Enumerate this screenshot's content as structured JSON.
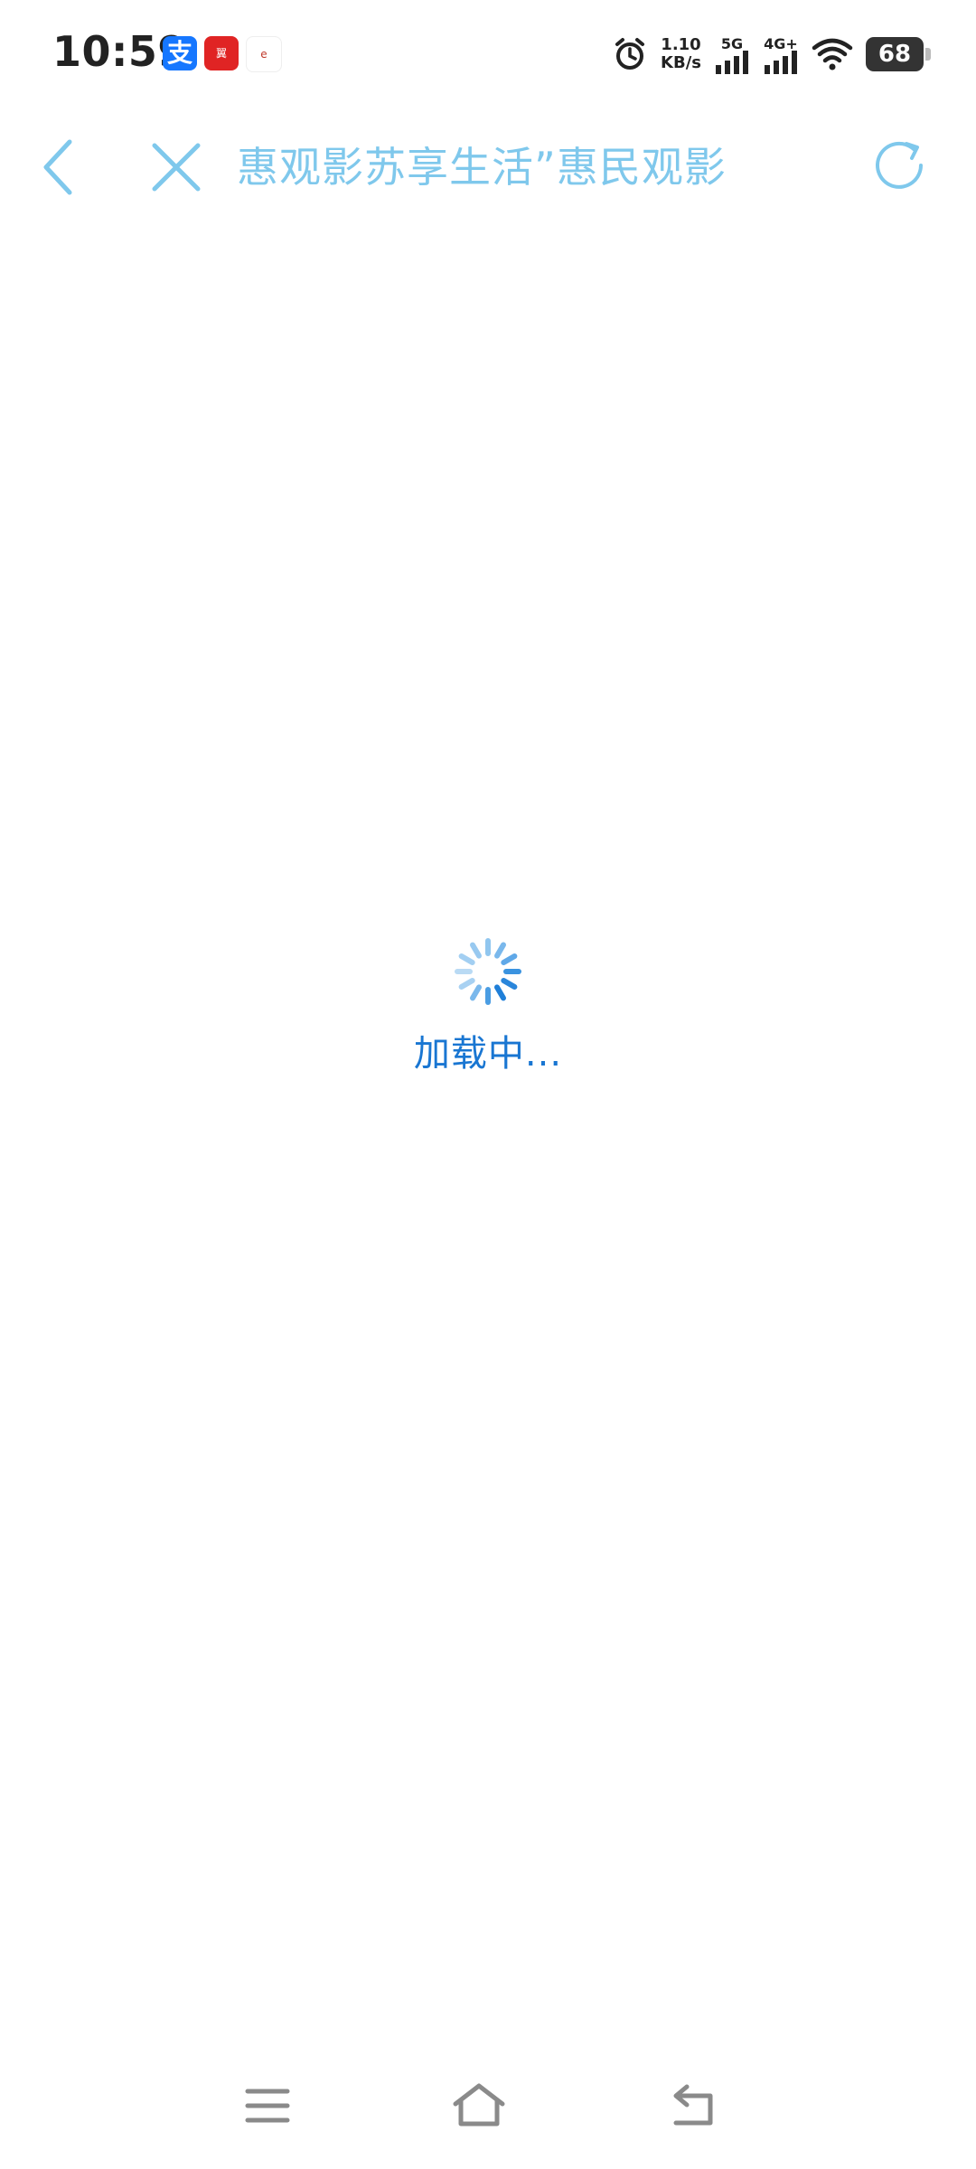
{
  "status_bar": {
    "time": "10:59",
    "apps": [
      {
        "name": "alipay",
        "label": "支"
      },
      {
        "name": "app2",
        "label": "翼"
      },
      {
        "name": "app3",
        "label": "e"
      }
    ],
    "net_speed_value": "1.10",
    "net_speed_unit": "KB/s",
    "signal1_label": "5G",
    "signal2_label": "4G+",
    "battery": "68"
  },
  "nav": {
    "title": "惠观影苏享生活”惠民观影"
  },
  "loading": {
    "text": "加载中..."
  },
  "colors": {
    "accent": "#7fc8ec",
    "loading_text": "#1976d2"
  }
}
